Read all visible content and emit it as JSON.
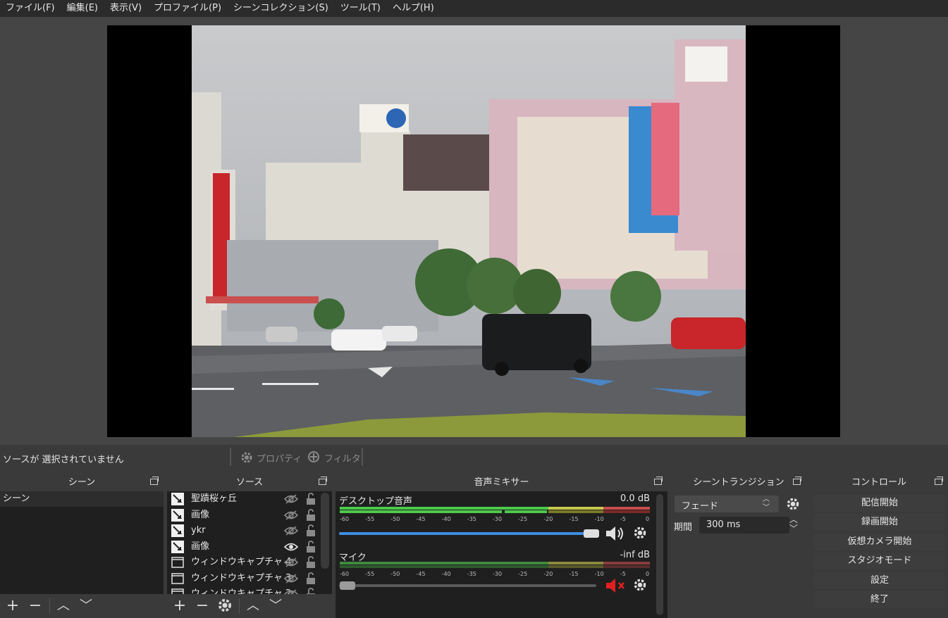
{
  "menu": [
    "ファイル(F)",
    "編集(E)",
    "表示(V)",
    "プロファイル(P)",
    "シーンコレクション(S)",
    "ツール(T)",
    "ヘルプ(H)"
  ],
  "status": {
    "no_source": "ソースが 選択されていません",
    "properties": "プロパティ",
    "filters": "フィルタ"
  },
  "docks": {
    "scenes": {
      "title": "シーン",
      "items": [
        "シーン"
      ]
    },
    "sources": {
      "title": "ソース",
      "items": [
        {
          "label": "聖蹟桜ヶ丘",
          "type": "image-icon",
          "visible": false
        },
        {
          "label": "画像",
          "type": "image-icon",
          "visible": false
        },
        {
          "label": "ykr",
          "type": "image-icon",
          "visible": false
        },
        {
          "label": "画像",
          "type": "image-icon",
          "visible": true
        },
        {
          "label": "ウィンドウキャプチャ 4",
          "type": "window-icon",
          "visible": false
        },
        {
          "label": "ウィンドウキャプチャ 3",
          "type": "window-icon",
          "visible": false
        },
        {
          "label": "ウィンドウキャプチャ 2",
          "type": "window-icon",
          "visible": false
        }
      ]
    },
    "mixer": {
      "title": "音声ミキサー",
      "channels": [
        {
          "name": "デスクトップ音声",
          "level": "0.0 dB",
          "volume_fraction": 1.0,
          "muted": false
        },
        {
          "name": "マイク",
          "level": "-inf dB",
          "volume_fraction": 0.0,
          "muted": true
        }
      ],
      "ticks": [
        "-60",
        "-55",
        "-50",
        "-45",
        "-40",
        "-35",
        "-30",
        "-25",
        "-20",
        "-15",
        "-10",
        "-5",
        "0"
      ]
    },
    "transitions": {
      "title": "シーントランジション",
      "selected": "フェード",
      "duration_label": "期間",
      "duration_value": "300 ms"
    },
    "controls": {
      "title": "コントロール",
      "buttons": [
        "配信開始",
        "録画開始",
        "仮想カメラ開始",
        "スタジオモード",
        "設定",
        "終了"
      ]
    }
  },
  "colors": {
    "meter_green": "#4cc94c",
    "meter_yellow": "#c9c94c",
    "meter_red": "#c94c4c",
    "volume_blue": "#3d8ee0",
    "muted_red": "#e02020"
  }
}
